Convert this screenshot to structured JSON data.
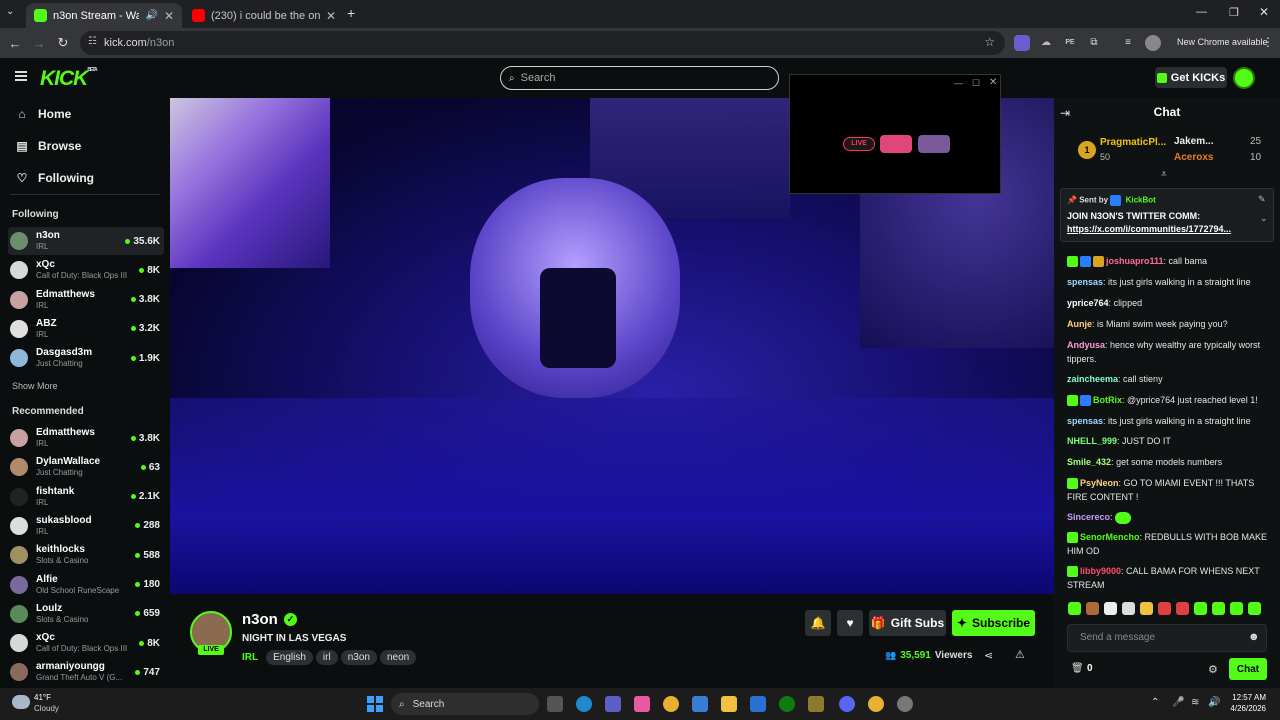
{
  "browser": {
    "tabs": [
      {
        "title": "n3on Stream - Watch Live o",
        "active": true
      },
      {
        "title": "(230) i could be the one (Amb",
        "active": false
      }
    ],
    "url_host": "kick.com",
    "url_path": "/n3on",
    "profile_text": "New Chrome available"
  },
  "header": {
    "logo": "KICK",
    "logo_sup": "BETA",
    "search_placeholder": "Search",
    "get_kicks": "Get KICKs"
  },
  "sidebar": {
    "nav": [
      {
        "label": "Home",
        "icon": "home-icon"
      },
      {
        "label": "Browse",
        "icon": "browse-icon"
      },
      {
        "label": "Following",
        "icon": "heart-icon"
      }
    ],
    "following_heading": "Following",
    "following": [
      {
        "name": "n3on",
        "category": "IRL",
        "viewers": "35.6K",
        "color": "#6b8f6b"
      },
      {
        "name": "xQc",
        "category": "Call of Duty: Black Ops III",
        "viewers": "8K",
        "color": "#d8d8d8"
      },
      {
        "name": "Edmatthews",
        "category": "IRL",
        "viewers": "3.8K",
        "color": "#c9a0a0"
      },
      {
        "name": "ABZ",
        "category": "IRL",
        "viewers": "3.2K",
        "color": "#e0e0e0"
      },
      {
        "name": "Dasgasd3m",
        "category": "Just Chatting",
        "viewers": "1.9K",
        "color": "#8fb7d8"
      }
    ],
    "show_more": "Show More",
    "recommended_heading": "Recommended",
    "recommended": [
      {
        "name": "Edmatthews",
        "category": "IRL",
        "viewers": "3.8K",
        "color": "#c9a0a0"
      },
      {
        "name": "DylanWallace",
        "category": "Just Chatting",
        "viewers": "63",
        "color": "#b08a6a"
      },
      {
        "name": "fishtank",
        "category": "IRL",
        "viewers": "2.1K",
        "color": "#222222"
      },
      {
        "name": "sukasblood",
        "category": "IRL",
        "viewers": "288",
        "color": "#dddddd"
      },
      {
        "name": "keithlocks",
        "category": "Slots & Casino",
        "viewers": "588",
        "color": "#a08f60"
      },
      {
        "name": "Alfie",
        "category": "Old School RuneScape",
        "viewers": "180",
        "color": "#7a6a9a"
      },
      {
        "name": "Loulz",
        "category": "Slots & Casino",
        "viewers": "659",
        "color": "#5a8a5a"
      },
      {
        "name": "xQc",
        "category": "Call of Duty: Black Ops III",
        "viewers": "8K",
        "color": "#d8d8d8"
      },
      {
        "name": "armaniyoungg",
        "category": "Grand Theft Auto V (G...",
        "viewers": "747",
        "color": "#8a6a5a"
      }
    ]
  },
  "stream": {
    "name": "n3on",
    "title": "NIGHT IN LAS VEGAS",
    "category": "IRL",
    "tags": [
      "English",
      "irl",
      "n3on",
      "neon"
    ],
    "live_label": "LIVE",
    "gift_subs": "Gift Subs",
    "subscribe": "Subscribe",
    "viewers": "35,591",
    "viewers_label": "Viewers"
  },
  "popup": {
    "live_label": "LIVE"
  },
  "chat": {
    "title": "Chat",
    "leaderboard": [
      {
        "rank": "1",
        "name": "PragmaticPl...",
        "value": "50"
      },
      {
        "name": "Jakem...",
        "value": "25"
      },
      {
        "name": "Aceroxs",
        "value": "10"
      }
    ],
    "pinned": {
      "sent_by": "Sent by",
      "sender": "KickBot",
      "line1": "JOIN N3ON'S TWITTER COMM:",
      "line2": "https://x.com/i/communities/1772794..."
    },
    "messages": [
      {
        "user": "joshuapro111",
        "text": "call bama",
        "color": "#ff6b9d",
        "badges": 3
      },
      {
        "user": "spensas",
        "text": "its just girls walking in a straight line",
        "color": "#9fd7ff",
        "badges": 0
      },
      {
        "user": "yprice764",
        "text": "clipped",
        "color": "#ffffff",
        "badges": 0
      },
      {
        "user": "Aunje",
        "text": "is Miami swim week paying you?",
        "color": "#ffd27f",
        "badges": 0
      },
      {
        "user": "Andyusa",
        "text": "hence why wealthy are typically worst tippers.",
        "color": "#ff9ad5",
        "badges": 0
      },
      {
        "user": "zaincheema",
        "text": "call stieny",
        "color": "#7fffd4",
        "badges": 0
      },
      {
        "user": "BotRix",
        "text": "@yprice764 just reached level 1!",
        "color": "#53fc18",
        "badges": 2
      },
      {
        "user": "spensas",
        "text": "its just girls walking in a straight line",
        "color": "#9fd7ff",
        "badges": 0
      },
      {
        "user": "NHELL_999",
        "text": "JUST DO IT",
        "color": "#7cff7c",
        "badges": 0
      },
      {
        "user": "Smile_432",
        "text": "get some models numbers",
        "color": "#a6ff7f",
        "badges": 0
      },
      {
        "user": "PsyNeon",
        "text": "GO TO MIAMI EVENT !!! THATS FIRE CONTENT !",
        "color": "#ffd27f",
        "badges": 1
      },
      {
        "user": "Sincereco",
        "text": "",
        "color": "#c89bff",
        "badges": 0
      },
      {
        "user": "SenorMencho",
        "text": "REDBULLS WITH BOB MAKE HIM OD",
        "color": "#53fc18",
        "badges": 1
      },
      {
        "user": "libby9000",
        "text": "CALL BAMA FOR WHENS NEXT STREAM",
        "color": "#ff4d6d",
        "badges": 1
      }
    ],
    "input_placeholder": "Send a message",
    "points": "0",
    "send": "Chat"
  },
  "taskbar": {
    "weather_temp": "41°F",
    "weather_text": "Cloudy",
    "search_label": "Search",
    "time": "12:57 AM",
    "date": "4/26/2026"
  }
}
